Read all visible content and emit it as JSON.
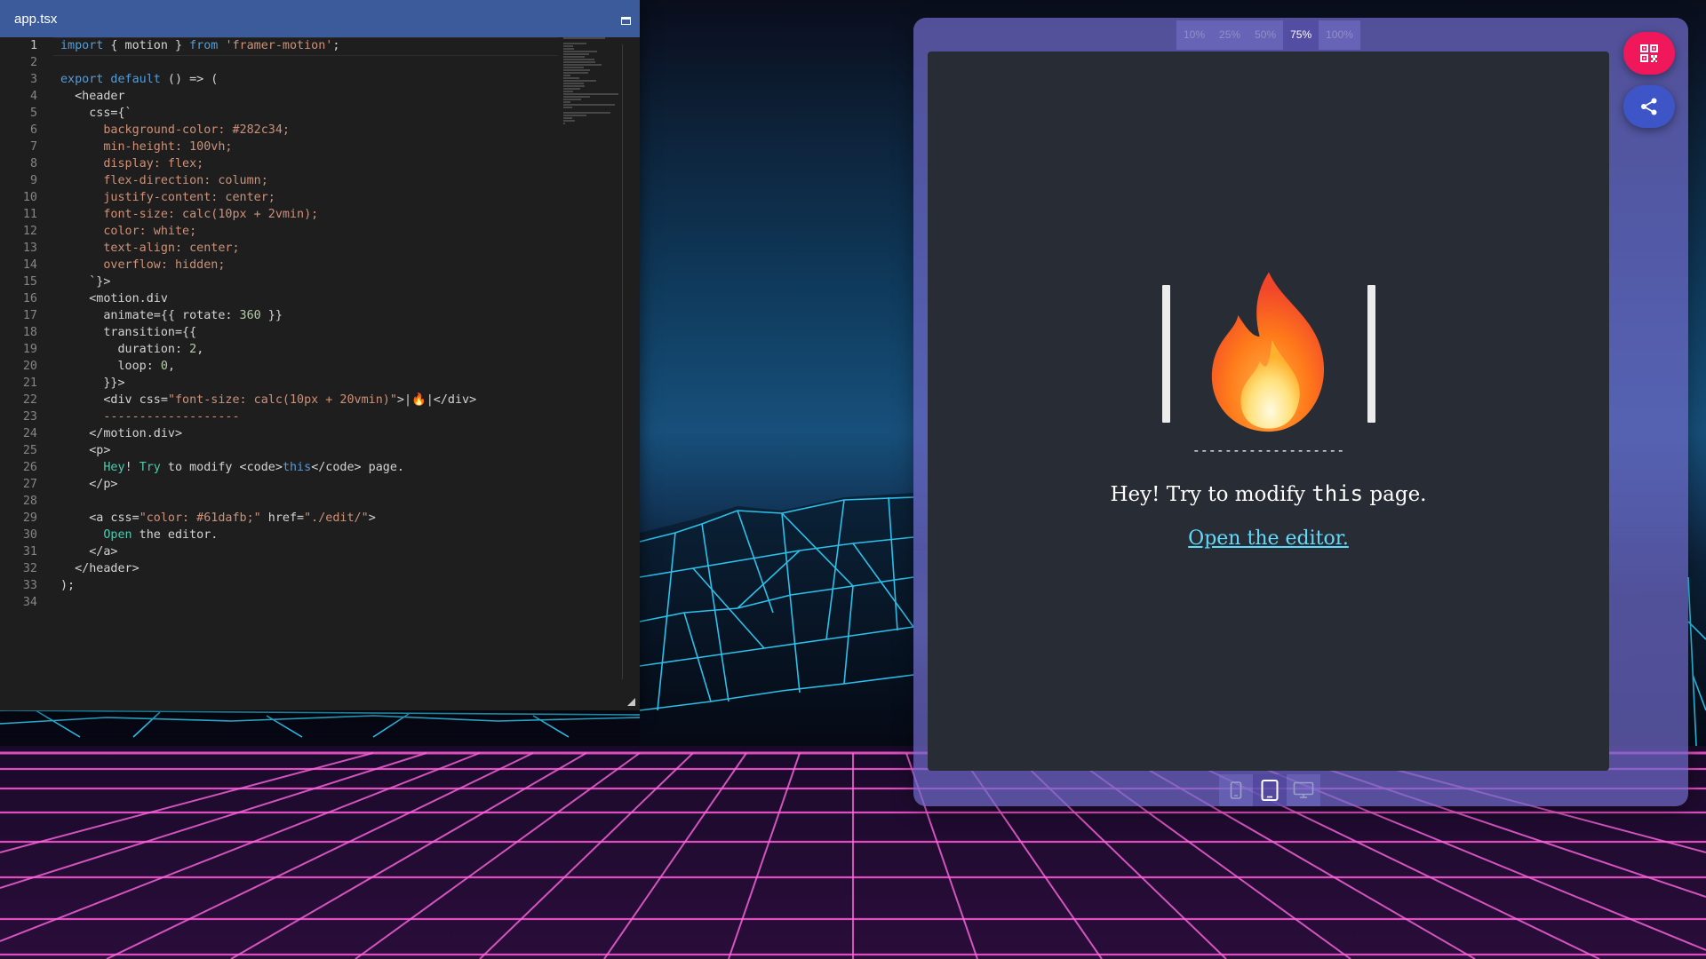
{
  "editor": {
    "filename": "app.tsx",
    "code_lines": [
      [
        [
          "import",
          "kw"
        ],
        [
          " { motion } ",
          "p"
        ],
        [
          "from",
          "kw"
        ],
        [
          " ",
          "p"
        ],
        [
          "'framer-motion'",
          "str"
        ],
        [
          ";",
          "p"
        ]
      ],
      [],
      [
        [
          "export default",
          "kw"
        ],
        [
          " () => (",
          "p"
        ]
      ],
      [
        [
          "  <header",
          "p"
        ]
      ],
      [
        [
          "    css={`",
          "p"
        ]
      ],
      [
        [
          "      background-color: #282c34;",
          "str"
        ]
      ],
      [
        [
          "      min-height: 100vh;",
          "str"
        ]
      ],
      [
        [
          "      display: flex;",
          "str"
        ]
      ],
      [
        [
          "      flex-direction: column;",
          "str"
        ]
      ],
      [
        [
          "      justify-content: center;",
          "str"
        ]
      ],
      [
        [
          "      font-size: calc(10px + 2vmin);",
          "str"
        ]
      ],
      [
        [
          "      color: white;",
          "str"
        ]
      ],
      [
        [
          "      text-align: center;",
          "str"
        ]
      ],
      [
        [
          "      overflow: hidden;",
          "str"
        ]
      ],
      [
        [
          "    `}>",
          "p"
        ]
      ],
      [
        [
          "    <motion.div",
          "p"
        ]
      ],
      [
        [
          "      animate={{ rotate: ",
          "p"
        ],
        [
          "360",
          "num"
        ],
        [
          " }}",
          "p"
        ]
      ],
      [
        [
          "      transition={{",
          "p"
        ]
      ],
      [
        [
          "        duration: ",
          "p"
        ],
        [
          "2",
          "num"
        ],
        [
          ",",
          "p"
        ]
      ],
      [
        [
          "        loop: ",
          "p"
        ],
        [
          "0",
          "num"
        ],
        [
          ",",
          "p"
        ]
      ],
      [
        [
          "      }}>",
          "p"
        ]
      ],
      [
        [
          "      <div css=",
          "p"
        ],
        [
          "\"font-size: calc(10px + 20vmin)\"",
          "str"
        ],
        [
          ">|🔥|</div>",
          "p"
        ]
      ],
      [
        [
          "      -------------------",
          "str"
        ]
      ],
      [
        [
          "    </motion.div>",
          "p"
        ]
      ],
      [
        [
          "    <p>",
          "p"
        ]
      ],
      [
        [
          "      ",
          "p"
        ],
        [
          "Hey",
          "fn"
        ],
        [
          "! ",
          "p"
        ],
        [
          "Try",
          "fn"
        ],
        [
          " to modify <code>",
          "p"
        ],
        [
          "this",
          "kw"
        ],
        [
          "</code> page.",
          "p"
        ]
      ],
      [
        [
          "    </p>",
          "p"
        ]
      ],
      [],
      [
        [
          "    <a css=",
          "p"
        ],
        [
          "\"color: #61dafb;\"",
          "str"
        ],
        [
          " href=",
          "p"
        ],
        [
          "\"./edit/\"",
          "str"
        ],
        [
          ">",
          "p"
        ]
      ],
      [
        [
          "      ",
          "p"
        ],
        [
          "Open",
          "fn"
        ],
        [
          " the editor.",
          "p"
        ]
      ],
      [
        [
          "    </a>",
          "p"
        ]
      ],
      [
        [
          "  </header>",
          "p"
        ]
      ],
      [
        [
          ");",
          "p"
        ]
      ],
      []
    ]
  },
  "preview": {
    "zoom_options": [
      "10%",
      "25%",
      "50%",
      "75%",
      "100%"
    ],
    "zoom_selected": "75%",
    "page": {
      "spinner_text": "|🔥|",
      "dashes": "-------------------",
      "text_before": "Hey! Try to modify ",
      "code_word": "this",
      "text_after": " page.",
      "link_text": "Open the editor."
    },
    "devices": [
      "phone-icon",
      "tablet-icon",
      "desktop-icon"
    ],
    "device_selected": "tablet-icon"
  },
  "fabs": {
    "qr": "qr-code-icon",
    "share": "share-icon"
  },
  "colors": {
    "titlebar": "#3b5b9a",
    "preview_bg": "#282c34",
    "link": "#61dafb",
    "fab_qr": "#f0185a",
    "fab_share": "#3d55c6"
  }
}
